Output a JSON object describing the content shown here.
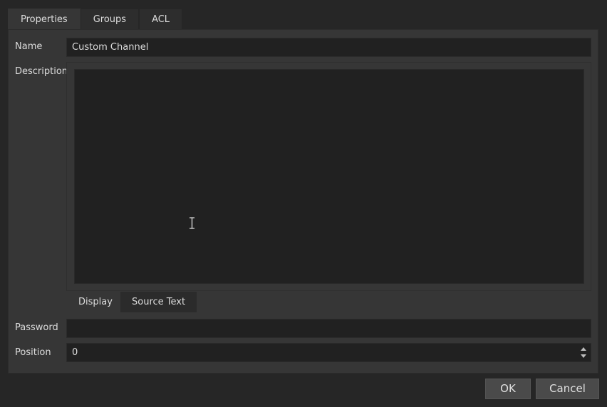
{
  "tabs": [
    "Properties",
    "Groups",
    "ACL"
  ],
  "active_tab": "Properties",
  "form": {
    "name_label": "Name",
    "name_value": "Custom Channel",
    "description_label": "Description",
    "description_value": "",
    "description_tabs": [
      "Display",
      "Source Text"
    ],
    "description_active_tab": "Source Text",
    "password_label": "Password",
    "password_value": "",
    "position_label": "Position",
    "position_value": "0"
  },
  "buttons": {
    "ok": "OK",
    "cancel": "Cancel"
  },
  "icons": {
    "cursor": "text-cursor-icon",
    "spin_up": "spin-up-icon",
    "spin_down": "spin-down-icon"
  }
}
